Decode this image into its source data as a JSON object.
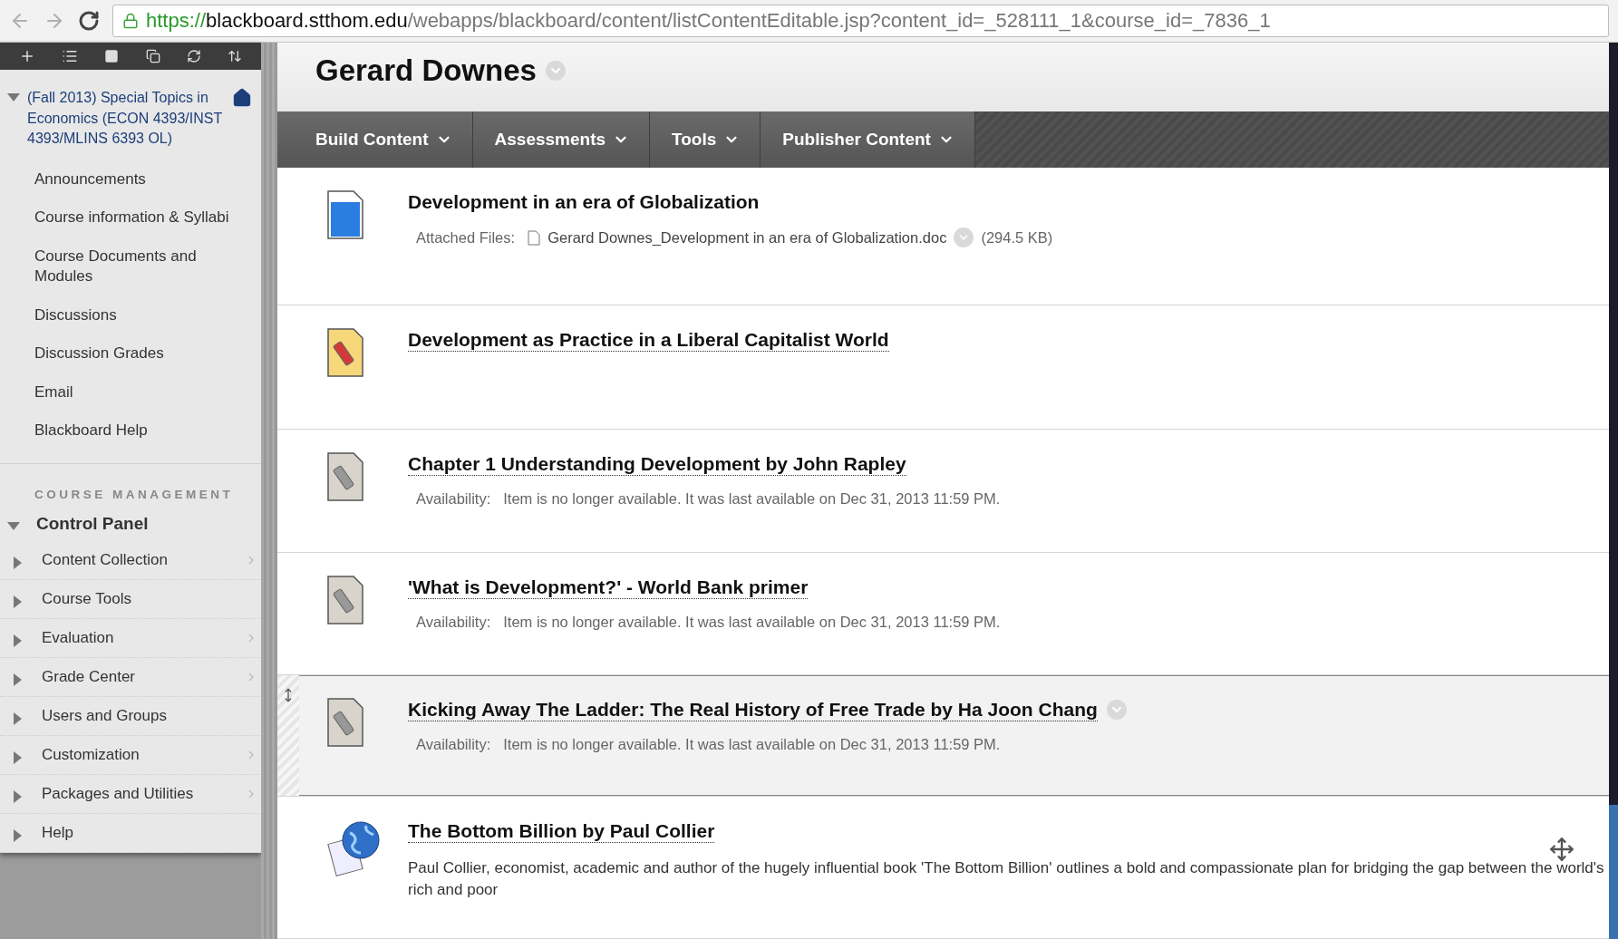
{
  "browser": {
    "url_scheme": "https://",
    "url_host": "blackboard.stthom.edu",
    "url_path": "/webapps/blackboard/content/listContentEditable.jsp?content_id=_528111_1&course_id=_7836_1"
  },
  "sidebar": {
    "course": {
      "title": "(Fall 2013) Special Topics in Economics (ECON 4393/INST 4393/MLINS 6393 OL)",
      "expanded": true
    },
    "items": [
      "Announcements",
      "Course information & Syllabi",
      "Course Documents and Modules",
      "Discussions",
      "Discussion Grades",
      "Email",
      "Blackboard Help"
    ],
    "management_heading": "COURSE MANAGEMENT",
    "control_panel": {
      "title": "Control Panel",
      "expanded": true,
      "items": [
        {
          "label": "Content Collection",
          "flyout": true
        },
        {
          "label": "Course Tools",
          "flyout": false
        },
        {
          "label": "Evaluation",
          "flyout": true
        },
        {
          "label": "Grade Center",
          "flyout": true
        },
        {
          "label": "Users and Groups",
          "flyout": false
        },
        {
          "label": "Customization",
          "flyout": true
        },
        {
          "label": "Packages and Utilities",
          "flyout": true
        },
        {
          "label": "Help",
          "flyout": false
        }
      ]
    }
  },
  "page": {
    "title": "Gerard Downes",
    "menu": [
      "Build Content",
      "Assessments",
      "Tools",
      "Publisher Content"
    ],
    "items": [
      {
        "title": "Development in an era of Globalization",
        "linked": false,
        "menu_button": false,
        "highlighted": false,
        "kind": "attachment",
        "label": "Attached Files:",
        "file": "Gerard Downes_Development in an era of Globalization.doc",
        "size": "(294.5 KB)"
      },
      {
        "title": "Development as Practice in a Liberal Capitalist World",
        "linked": true,
        "menu_button": false,
        "highlighted": false,
        "kind": "none"
      },
      {
        "title": "Chapter 1 Understanding Development by John Rapley",
        "linked": true,
        "menu_button": false,
        "highlighted": false,
        "kind": "availability",
        "label": "Availability:",
        "text": "Item is no longer available. It was last available on Dec 31, 2013 11:59 PM."
      },
      {
        "title": "'What is Development?' - World Bank primer",
        "linked": true,
        "menu_button": false,
        "highlighted": false,
        "kind": "availability",
        "label": "Availability:",
        "text": "Item is no longer available. It was last available on Dec 31, 2013 11:59 PM."
      },
      {
        "title": "Kicking Away The Ladder: The Real History of Free Trade by Ha Joon Chang",
        "linked": true,
        "menu_button": true,
        "highlighted": true,
        "kind": "availability",
        "label": "Availability:",
        "text": "Item is no longer available. It was last available on Dec 31, 2013 11:59 PM."
      },
      {
        "title": "The Bottom Billion by Paul Collier",
        "linked": true,
        "menu_button": false,
        "highlighted": false,
        "kind": "description",
        "text": "Paul Collier, economist, academic and author of the hugely influential book 'The Bottom Billion' outlines a bold and compassionate plan for bridging the gap between the world's rich and poor"
      }
    ]
  }
}
